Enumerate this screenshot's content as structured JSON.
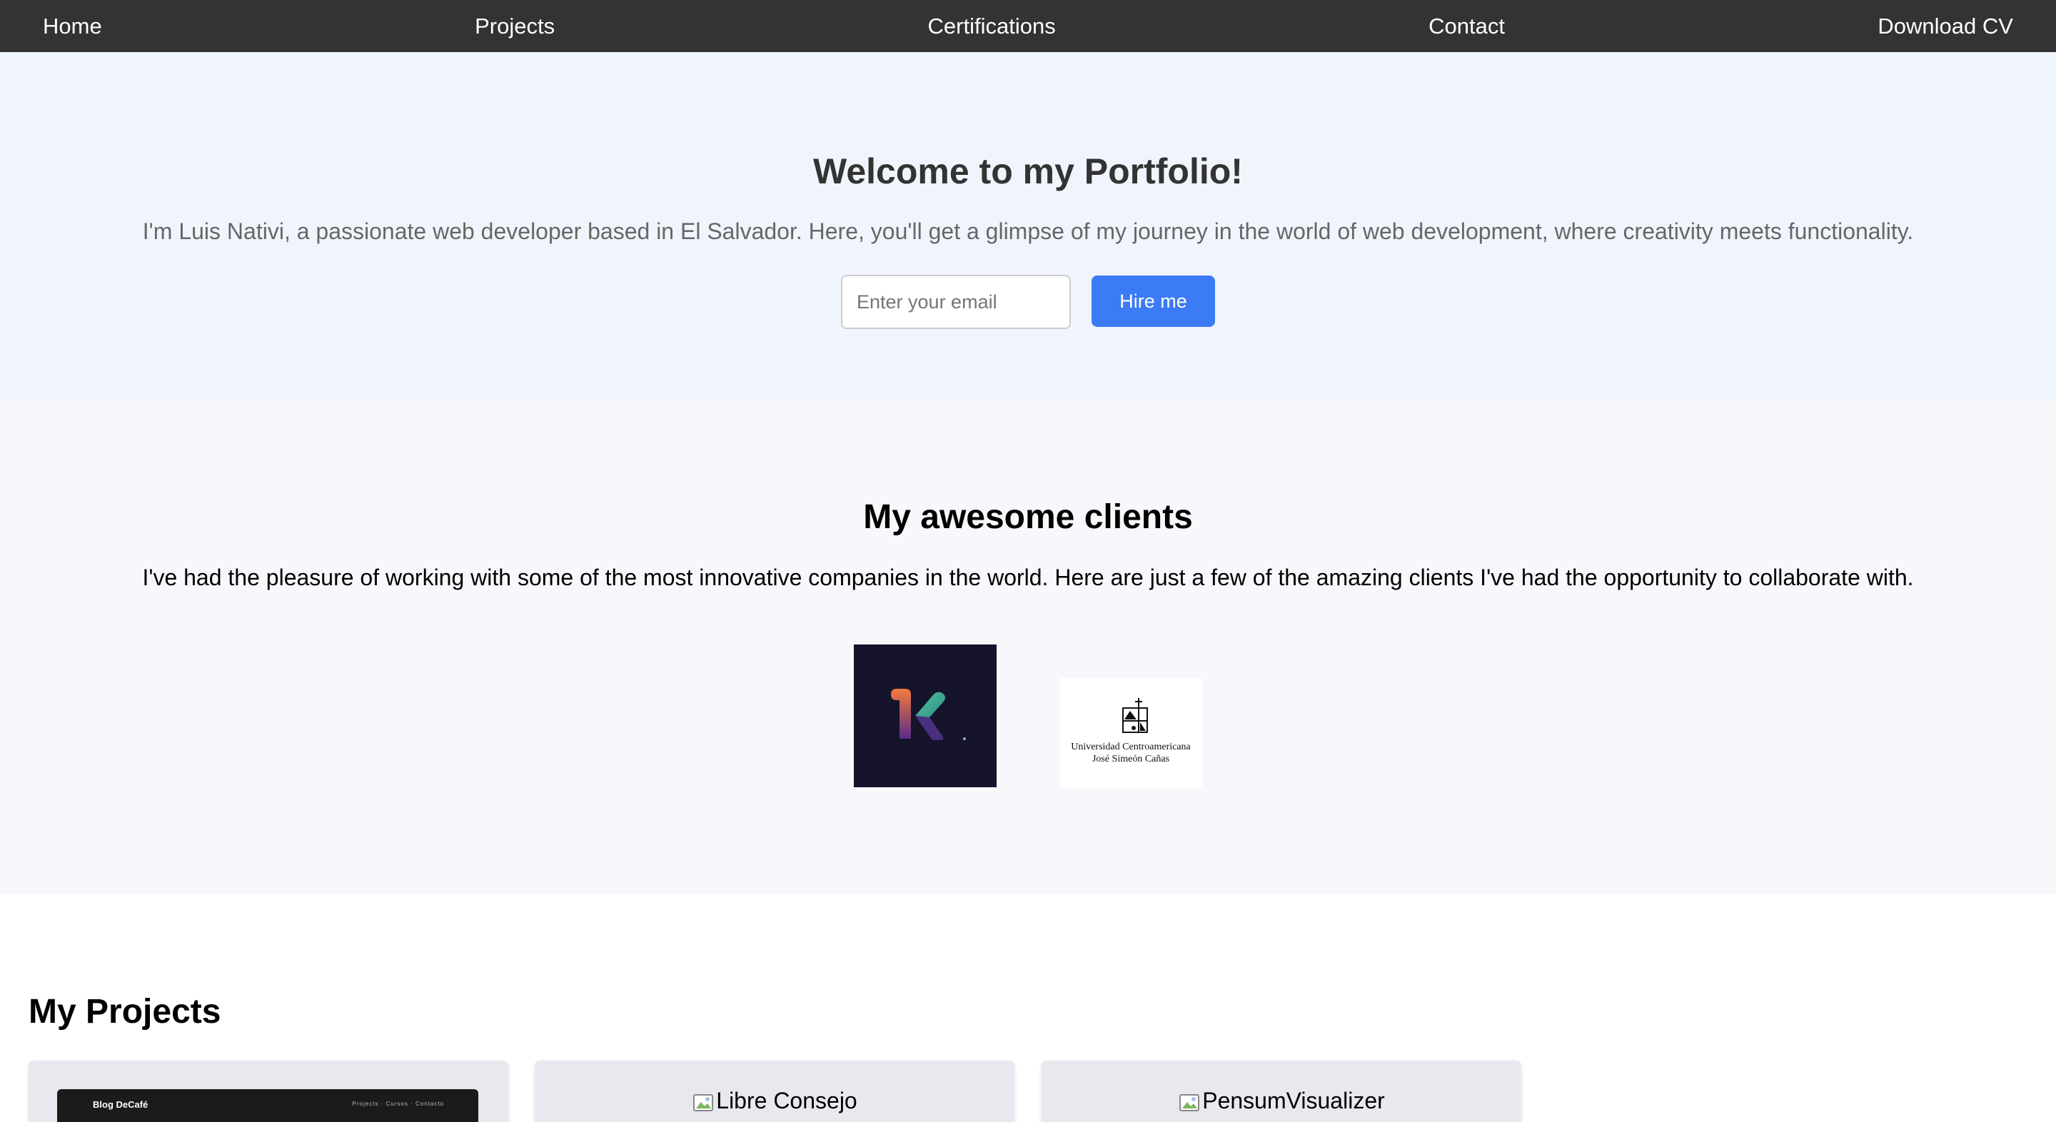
{
  "nav": {
    "items": [
      "Home",
      "Projects",
      "Certifications",
      "Contact",
      "Download CV"
    ]
  },
  "hero": {
    "title": "Welcome to my Portfolio!",
    "subtitle": "I'm Luis Nativi, a passionate web developer based in El Salvador. Here, you'll get a glimpse of my journey in the world of web development, where creativity meets functionality.",
    "email_placeholder": "Enter your email",
    "hire_button": "Hire me"
  },
  "clients": {
    "title": "My awesome clients",
    "description": "I've had the pleasure of working with some of the most innovative companies in the world. Here are just a few of the amazing clients I've had the opportunity to collaborate with.",
    "logos": [
      {
        "name": "k-logo"
      },
      {
        "name": "uca-logo",
        "text_line1": "Universidad Centroamericana",
        "text_line2": "José Simeón Cañas"
      }
    ]
  },
  "projects": {
    "title": "My Projects",
    "cards": [
      {
        "preview_brand": "Blog DeCafé",
        "preview_nav": "Projects · Cursos · Contacto"
      },
      {
        "alt": "Libre Consejo"
      },
      {
        "alt": "PensumVisualizer"
      }
    ]
  },
  "colors": {
    "nav_bg": "#333333",
    "hero_bg": "#f0f5fd",
    "clients_bg": "#f6f8fb",
    "accent": "#3b7bf6"
  }
}
